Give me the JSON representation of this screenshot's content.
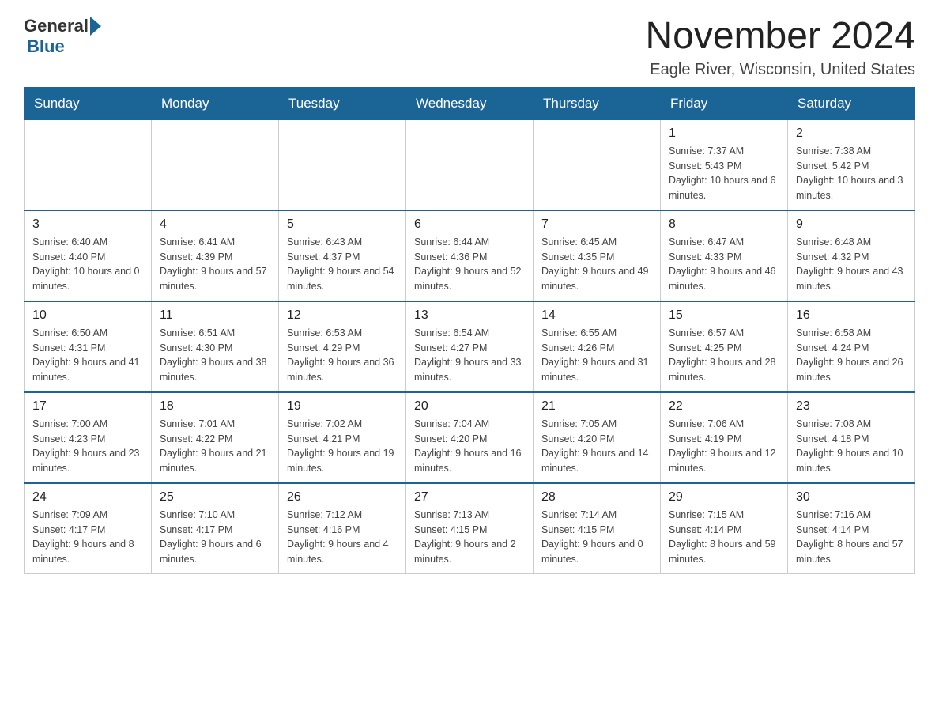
{
  "header": {
    "logo": {
      "general": "General",
      "blue": "Blue"
    },
    "title": "November 2024",
    "location": "Eagle River, Wisconsin, United States"
  },
  "calendar": {
    "days": [
      "Sunday",
      "Monday",
      "Tuesday",
      "Wednesday",
      "Thursday",
      "Friday",
      "Saturday"
    ],
    "weeks": [
      [
        {
          "day": "",
          "info": ""
        },
        {
          "day": "",
          "info": ""
        },
        {
          "day": "",
          "info": ""
        },
        {
          "day": "",
          "info": ""
        },
        {
          "day": "",
          "info": ""
        },
        {
          "day": "1",
          "info": "Sunrise: 7:37 AM\nSunset: 5:43 PM\nDaylight: 10 hours and 6 minutes."
        },
        {
          "day": "2",
          "info": "Sunrise: 7:38 AM\nSunset: 5:42 PM\nDaylight: 10 hours and 3 minutes."
        }
      ],
      [
        {
          "day": "3",
          "info": "Sunrise: 6:40 AM\nSunset: 4:40 PM\nDaylight: 10 hours and 0 minutes."
        },
        {
          "day": "4",
          "info": "Sunrise: 6:41 AM\nSunset: 4:39 PM\nDaylight: 9 hours and 57 minutes."
        },
        {
          "day": "5",
          "info": "Sunrise: 6:43 AM\nSunset: 4:37 PM\nDaylight: 9 hours and 54 minutes."
        },
        {
          "day": "6",
          "info": "Sunrise: 6:44 AM\nSunset: 4:36 PM\nDaylight: 9 hours and 52 minutes."
        },
        {
          "day": "7",
          "info": "Sunrise: 6:45 AM\nSunset: 4:35 PM\nDaylight: 9 hours and 49 minutes."
        },
        {
          "day": "8",
          "info": "Sunrise: 6:47 AM\nSunset: 4:33 PM\nDaylight: 9 hours and 46 minutes."
        },
        {
          "day": "9",
          "info": "Sunrise: 6:48 AM\nSunset: 4:32 PM\nDaylight: 9 hours and 43 minutes."
        }
      ],
      [
        {
          "day": "10",
          "info": "Sunrise: 6:50 AM\nSunset: 4:31 PM\nDaylight: 9 hours and 41 minutes."
        },
        {
          "day": "11",
          "info": "Sunrise: 6:51 AM\nSunset: 4:30 PM\nDaylight: 9 hours and 38 minutes."
        },
        {
          "day": "12",
          "info": "Sunrise: 6:53 AM\nSunset: 4:29 PM\nDaylight: 9 hours and 36 minutes."
        },
        {
          "day": "13",
          "info": "Sunrise: 6:54 AM\nSunset: 4:27 PM\nDaylight: 9 hours and 33 minutes."
        },
        {
          "day": "14",
          "info": "Sunrise: 6:55 AM\nSunset: 4:26 PM\nDaylight: 9 hours and 31 minutes."
        },
        {
          "day": "15",
          "info": "Sunrise: 6:57 AM\nSunset: 4:25 PM\nDaylight: 9 hours and 28 minutes."
        },
        {
          "day": "16",
          "info": "Sunrise: 6:58 AM\nSunset: 4:24 PM\nDaylight: 9 hours and 26 minutes."
        }
      ],
      [
        {
          "day": "17",
          "info": "Sunrise: 7:00 AM\nSunset: 4:23 PM\nDaylight: 9 hours and 23 minutes."
        },
        {
          "day": "18",
          "info": "Sunrise: 7:01 AM\nSunset: 4:22 PM\nDaylight: 9 hours and 21 minutes."
        },
        {
          "day": "19",
          "info": "Sunrise: 7:02 AM\nSunset: 4:21 PM\nDaylight: 9 hours and 19 minutes."
        },
        {
          "day": "20",
          "info": "Sunrise: 7:04 AM\nSunset: 4:20 PM\nDaylight: 9 hours and 16 minutes."
        },
        {
          "day": "21",
          "info": "Sunrise: 7:05 AM\nSunset: 4:20 PM\nDaylight: 9 hours and 14 minutes."
        },
        {
          "day": "22",
          "info": "Sunrise: 7:06 AM\nSunset: 4:19 PM\nDaylight: 9 hours and 12 minutes."
        },
        {
          "day": "23",
          "info": "Sunrise: 7:08 AM\nSunset: 4:18 PM\nDaylight: 9 hours and 10 minutes."
        }
      ],
      [
        {
          "day": "24",
          "info": "Sunrise: 7:09 AM\nSunset: 4:17 PM\nDaylight: 9 hours and 8 minutes."
        },
        {
          "day": "25",
          "info": "Sunrise: 7:10 AM\nSunset: 4:17 PM\nDaylight: 9 hours and 6 minutes."
        },
        {
          "day": "26",
          "info": "Sunrise: 7:12 AM\nSunset: 4:16 PM\nDaylight: 9 hours and 4 minutes."
        },
        {
          "day": "27",
          "info": "Sunrise: 7:13 AM\nSunset: 4:15 PM\nDaylight: 9 hours and 2 minutes."
        },
        {
          "day": "28",
          "info": "Sunrise: 7:14 AM\nSunset: 4:15 PM\nDaylight: 9 hours and 0 minutes."
        },
        {
          "day": "29",
          "info": "Sunrise: 7:15 AM\nSunset: 4:14 PM\nDaylight: 8 hours and 59 minutes."
        },
        {
          "day": "30",
          "info": "Sunrise: 7:16 AM\nSunset: 4:14 PM\nDaylight: 8 hours and 57 minutes."
        }
      ]
    ]
  }
}
